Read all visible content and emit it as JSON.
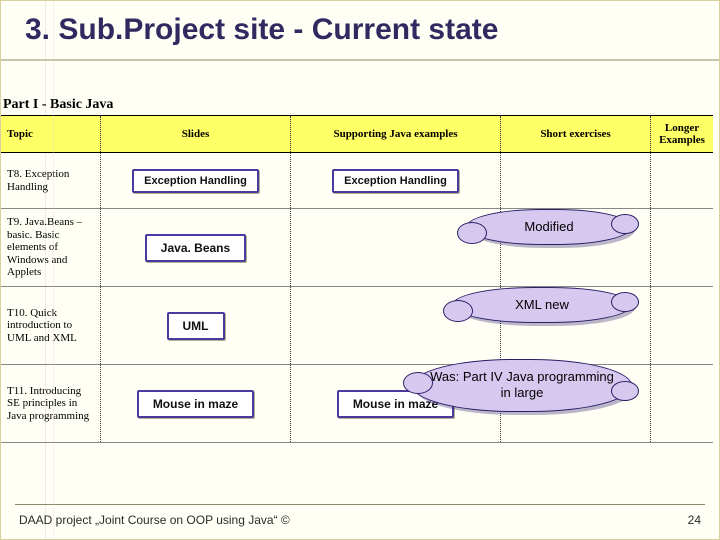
{
  "title": "3. Sub.Project site - Current state",
  "part_label": "Part I - Basic Java",
  "columns": {
    "c1": "Topic",
    "c2": "Slides",
    "c3": "Supporting Java examples",
    "c4": "Short exercises",
    "c5": "Longer Examples"
  },
  "rows": [
    {
      "topic": "T8. Exception Handling",
      "slides_btn": "Exception Handling",
      "examples_btn": "Exception Handling",
      "callout": null,
      "tall": false
    },
    {
      "topic": "T9. Java.Beans – basic. Basic elements of Windows and Applets",
      "slides_btn": "Java. Beans",
      "examples_btn": null,
      "callout": "Modified",
      "tall": true
    },
    {
      "topic": "T10. Quick introduction to UML and XML",
      "slides_btn": "UML",
      "examples_btn": null,
      "callout": "XML new",
      "tall": true
    },
    {
      "topic": "T11. Introducing SE principles in Java programming",
      "slides_btn": "Mouse in maze",
      "examples_btn": "Mouse in maze",
      "callout": "Was: Part IV Java programming in large",
      "tall": true
    }
  ],
  "footer_left": "DAAD project „Joint Course on OOP using Java“ ©",
  "footer_right": "24"
}
